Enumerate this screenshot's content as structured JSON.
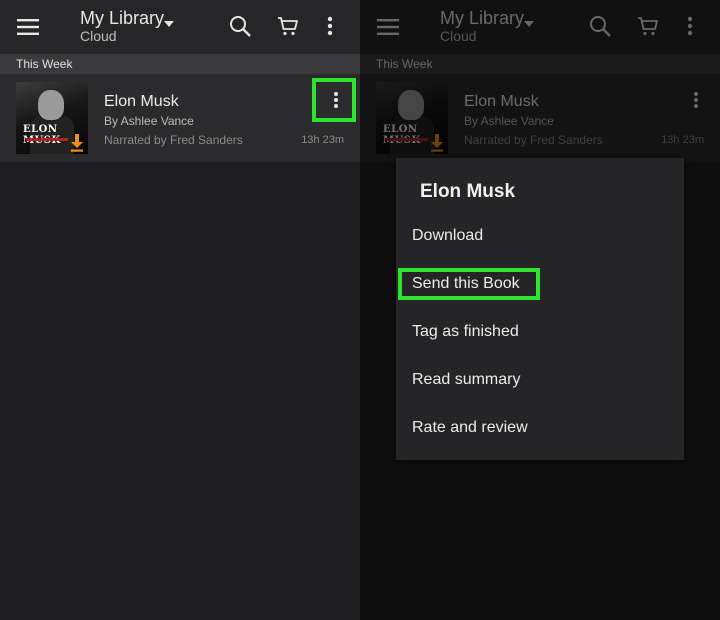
{
  "header": {
    "title": "My Library",
    "subtitle": "Cloud",
    "icons": [
      "hamburger-menu-icon",
      "search-icon",
      "cart-icon",
      "more-vertical-icon"
    ]
  },
  "section_label": "This Week",
  "book": {
    "title": "Elon Musk",
    "author": "By Ashlee Vance",
    "narrator": "Narrated by Fred Sanders",
    "duration": "13h 23m",
    "cover_text": "ELON MUSK"
  },
  "context_menu": {
    "title": "Elon Musk",
    "items": [
      "Download",
      "Send this Book",
      "Tag as finished",
      "Read summary",
      "Rate and review"
    ]
  },
  "colors": {
    "highlight": "#2fe42f",
    "background": "#1f1f21",
    "appbar": "#262628",
    "download_accent": "#f0901c"
  }
}
